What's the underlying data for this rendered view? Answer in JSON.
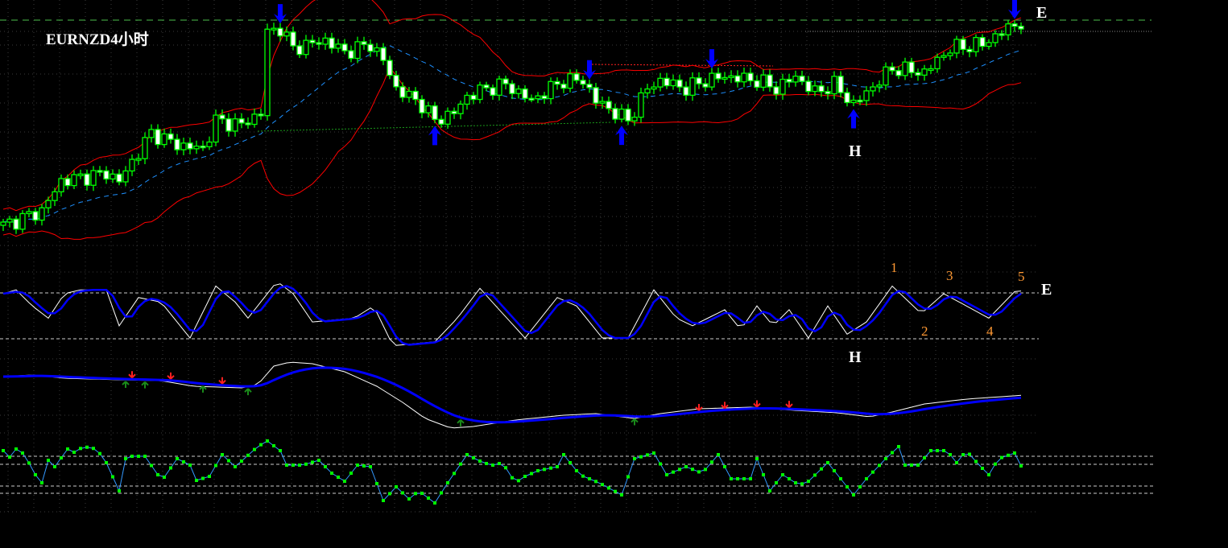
{
  "title": "EURNZD4小时",
  "colors": {
    "bg": "#000000",
    "grid": "#3a3a3a",
    "candle": "#00ff00",
    "bull_fill": "#000000",
    "bear_fill": "#ffffff",
    "band": "#ff0000",
    "mid": "#1e90ff",
    "arrow": "#0000ff",
    "stoch_main": "#ffffff",
    "stoch_signal": "#0000ff",
    "label": "#ffffff",
    "wave": "#ff9933",
    "rsi_line": "#3399ff",
    "rsi_dot": "#00ff00",
    "level_line": "#4cc04c"
  },
  "labels": {
    "e_top": "E",
    "h_top": "H",
    "e_osc": "E",
    "h_osc": "H",
    "waves": [
      "1",
      "2",
      "3",
      "4",
      "5"
    ]
  },
  "chart_data": {
    "type": "candlestick",
    "symbol": "EURNZD",
    "timeframe": "4小时",
    "bars": 159,
    "price_keypoints": [
      [
        0,
        50
      ],
      [
        6,
        68
      ],
      [
        9,
        105
      ],
      [
        16,
        115
      ],
      [
        18,
        105
      ],
      [
        23,
        165
      ],
      [
        27,
        150
      ],
      [
        31,
        145
      ],
      [
        33,
        180
      ],
      [
        37,
        175
      ],
      [
        40,
        190
      ],
      [
        41,
        290
      ],
      [
        43,
        295
      ],
      [
        45,
        270
      ],
      [
        50,
        280
      ],
      [
        53,
        265
      ],
      [
        57,
        275
      ],
      [
        59,
        255
      ],
      [
        61,
        220
      ],
      [
        65,
        200
      ],
      [
        67,
        180
      ],
      [
        70,
        190
      ],
      [
        72,
        210
      ],
      [
        75,
        220
      ],
      [
        78,
        225
      ],
      [
        82,
        205
      ],
      [
        87,
        230
      ],
      [
        90,
        230
      ],
      [
        92,
        205
      ],
      [
        95,
        190
      ],
      [
        97,
        180
      ],
      [
        100,
        220
      ],
      [
        102,
        230
      ],
      [
        106,
        220
      ],
      [
        109,
        230
      ],
      [
        112,
        235
      ],
      [
        117,
        230
      ],
      [
        120,
        220
      ],
      [
        123,
        235
      ],
      [
        126,
        215
      ],
      [
        129,
        225
      ],
      [
        132,
        200
      ],
      [
        134,
        215
      ],
      [
        138,
        245
      ],
      [
        143,
        240
      ],
      [
        147,
        270
      ],
      [
        152,
        275
      ],
      [
        157,
        300
      ],
      [
        158,
        300
      ]
    ],
    "bollinger": {
      "period": 20,
      "deviation": 2
    },
    "signals_down": [
      43,
      91,
      110,
      157
    ],
    "signals_up": [
      67,
      96,
      132
    ],
    "stochastic": {
      "levels": [
        80,
        20
      ],
      "main": [
        [
          0,
          79
        ],
        [
          2,
          84
        ],
        [
          4.5,
          63
        ],
        [
          7,
          47
        ],
        [
          9.5,
          79
        ],
        [
          12,
          84
        ],
        [
          16,
          84
        ],
        [
          18,
          37
        ],
        [
          21,
          74
        ],
        [
          24.5,
          68
        ],
        [
          29,
          21
        ],
        [
          33,
          89
        ],
        [
          36,
          68
        ],
        [
          38,
          47
        ],
        [
          42.5,
          95
        ],
        [
          45,
          79
        ],
        [
          48,
          42
        ],
        [
          54.5,
          47
        ],
        [
          57.5,
          63
        ],
        [
          60.5,
          11
        ],
        [
          67,
          16
        ],
        [
          70.5,
          47
        ],
        [
          74,
          86
        ],
        [
          77,
          58
        ],
        [
          81,
          21
        ],
        [
          86,
          74
        ],
        [
          89,
          63
        ],
        [
          93,
          21
        ],
        [
          97,
          21
        ],
        [
          101,
          84
        ],
        [
          104.5,
          47
        ],
        [
          107,
          37
        ],
        [
          112,
          58
        ],
        [
          114.5,
          32
        ],
        [
          117,
          63
        ],
        [
          119.5,
          37
        ],
        [
          122,
          58
        ],
        [
          125,
          21
        ],
        [
          128,
          63
        ],
        [
          131,
          26
        ],
        [
          134,
          42
        ],
        [
          138,
          89
        ],
        [
          142.5,
          53
        ],
        [
          146,
          79
        ],
        [
          153,
          47
        ],
        [
          157.5,
          86
        ],
        [
          158.5,
          79
        ]
      ],
      "wave_points": [
        138,
        143,
        146,
        153,
        158
      ]
    },
    "trend_indicator": {
      "main": [
        [
          0,
          72
        ],
        [
          4.5,
          74
        ],
        [
          9.5,
          70
        ],
        [
          18,
          68
        ],
        [
          24.5,
          67
        ],
        [
          29.5,
          60
        ],
        [
          37,
          58
        ],
        [
          39.5,
          62
        ],
        [
          42,
          85
        ],
        [
          44.5,
          90
        ],
        [
          48,
          88
        ],
        [
          53,
          78
        ],
        [
          58,
          60
        ],
        [
          62,
          40
        ],
        [
          65.5,
          20
        ],
        [
          69.5,
          8
        ],
        [
          73,
          10
        ],
        [
          79.5,
          18
        ],
        [
          87,
          24
        ],
        [
          92,
          26
        ],
        [
          98,
          20
        ],
        [
          102,
          26
        ],
        [
          108,
          32
        ],
        [
          116,
          34
        ],
        [
          123,
          30
        ],
        [
          129.5,
          27
        ],
        [
          134.5,
          22
        ],
        [
          138,
          28
        ],
        [
          143,
          38
        ],
        [
          149.5,
          44
        ],
        [
          158.5,
          49
        ]
      ],
      "sell_marks": [
        20,
        26,
        34,
        108,
        112,
        117,
        122
      ],
      "buy_marks": [
        19,
        22,
        31,
        38,
        71,
        98
      ]
    },
    "oscillator": {
      "levels": [
        73,
        63,
        36,
        27
      ],
      "values": [
        [
          0,
          80
        ],
        [
          1,
          72
        ],
        [
          1.5,
          82
        ],
        [
          2.5,
          82
        ],
        [
          3.5,
          72
        ],
        [
          5,
          50
        ],
        [
          6,
          40
        ],
        [
          7,
          68
        ],
        [
          8,
          60
        ],
        [
          10,
          82
        ],
        [
          11,
          78
        ],
        [
          12.5,
          85
        ],
        [
          14.5,
          82
        ],
        [
          16,
          65
        ],
        [
          18,
          30
        ],
        [
          19,
          70
        ],
        [
          20,
          73
        ],
        [
          22,
          73
        ],
        [
          24,
          50
        ],
        [
          25,
          47
        ],
        [
          27,
          70
        ],
        [
          29,
          62
        ],
        [
          30,
          43
        ],
        [
          32,
          48
        ],
        [
          34,
          75
        ],
        [
          36,
          60
        ],
        [
          37,
          67
        ],
        [
          39.5,
          85
        ],
        [
          41,
          92
        ],
        [
          43,
          80
        ],
        [
          44,
          62
        ],
        [
          46.5,
          62
        ],
        [
          49,
          68
        ],
        [
          51,
          52
        ],
        [
          53,
          42
        ],
        [
          55,
          62
        ],
        [
          57,
          60
        ],
        [
          59,
          18
        ],
        [
          61,
          35
        ],
        [
          63,
          20
        ],
        [
          64.5,
          30
        ],
        [
          67,
          15
        ],
        [
          69,
          40
        ],
        [
          72,
          75
        ],
        [
          74.5,
          65
        ],
        [
          76,
          62
        ],
        [
          77.5,
          65
        ],
        [
          79.5,
          40
        ],
        [
          81,
          48
        ],
        [
          83,
          55
        ],
        [
          86,
          60
        ],
        [
          87,
          75
        ],
        [
          89.5,
          50
        ],
        [
          92.5,
          40
        ],
        [
          96,
          25
        ],
        [
          98,
          70
        ],
        [
          101,
          77
        ],
        [
          103,
          50
        ],
        [
          106,
          60
        ],
        [
          108.5,
          52
        ],
        [
          111,
          75
        ],
        [
          113,
          45
        ],
        [
          116,
          45
        ],
        [
          117,
          70
        ],
        [
          119,
          30
        ],
        [
          121,
          50
        ],
        [
          123,
          40
        ],
        [
          124.5,
          38
        ],
        [
          128,
          65
        ],
        [
          129.5,
          50
        ],
        [
          132,
          25
        ],
        [
          134,
          45
        ],
        [
          137,
          70
        ],
        [
          139,
          85
        ],
        [
          139.5,
          62
        ],
        [
          142,
          62
        ],
        [
          144,
          80
        ],
        [
          146.5,
          80
        ],
        [
          148,
          65
        ],
        [
          149.5,
          80
        ],
        [
          151.5,
          62
        ],
        [
          153,
          50
        ],
        [
          154.5,
          70
        ],
        [
          157,
          77
        ],
        [
          158.5,
          53
        ]
      ]
    }
  }
}
